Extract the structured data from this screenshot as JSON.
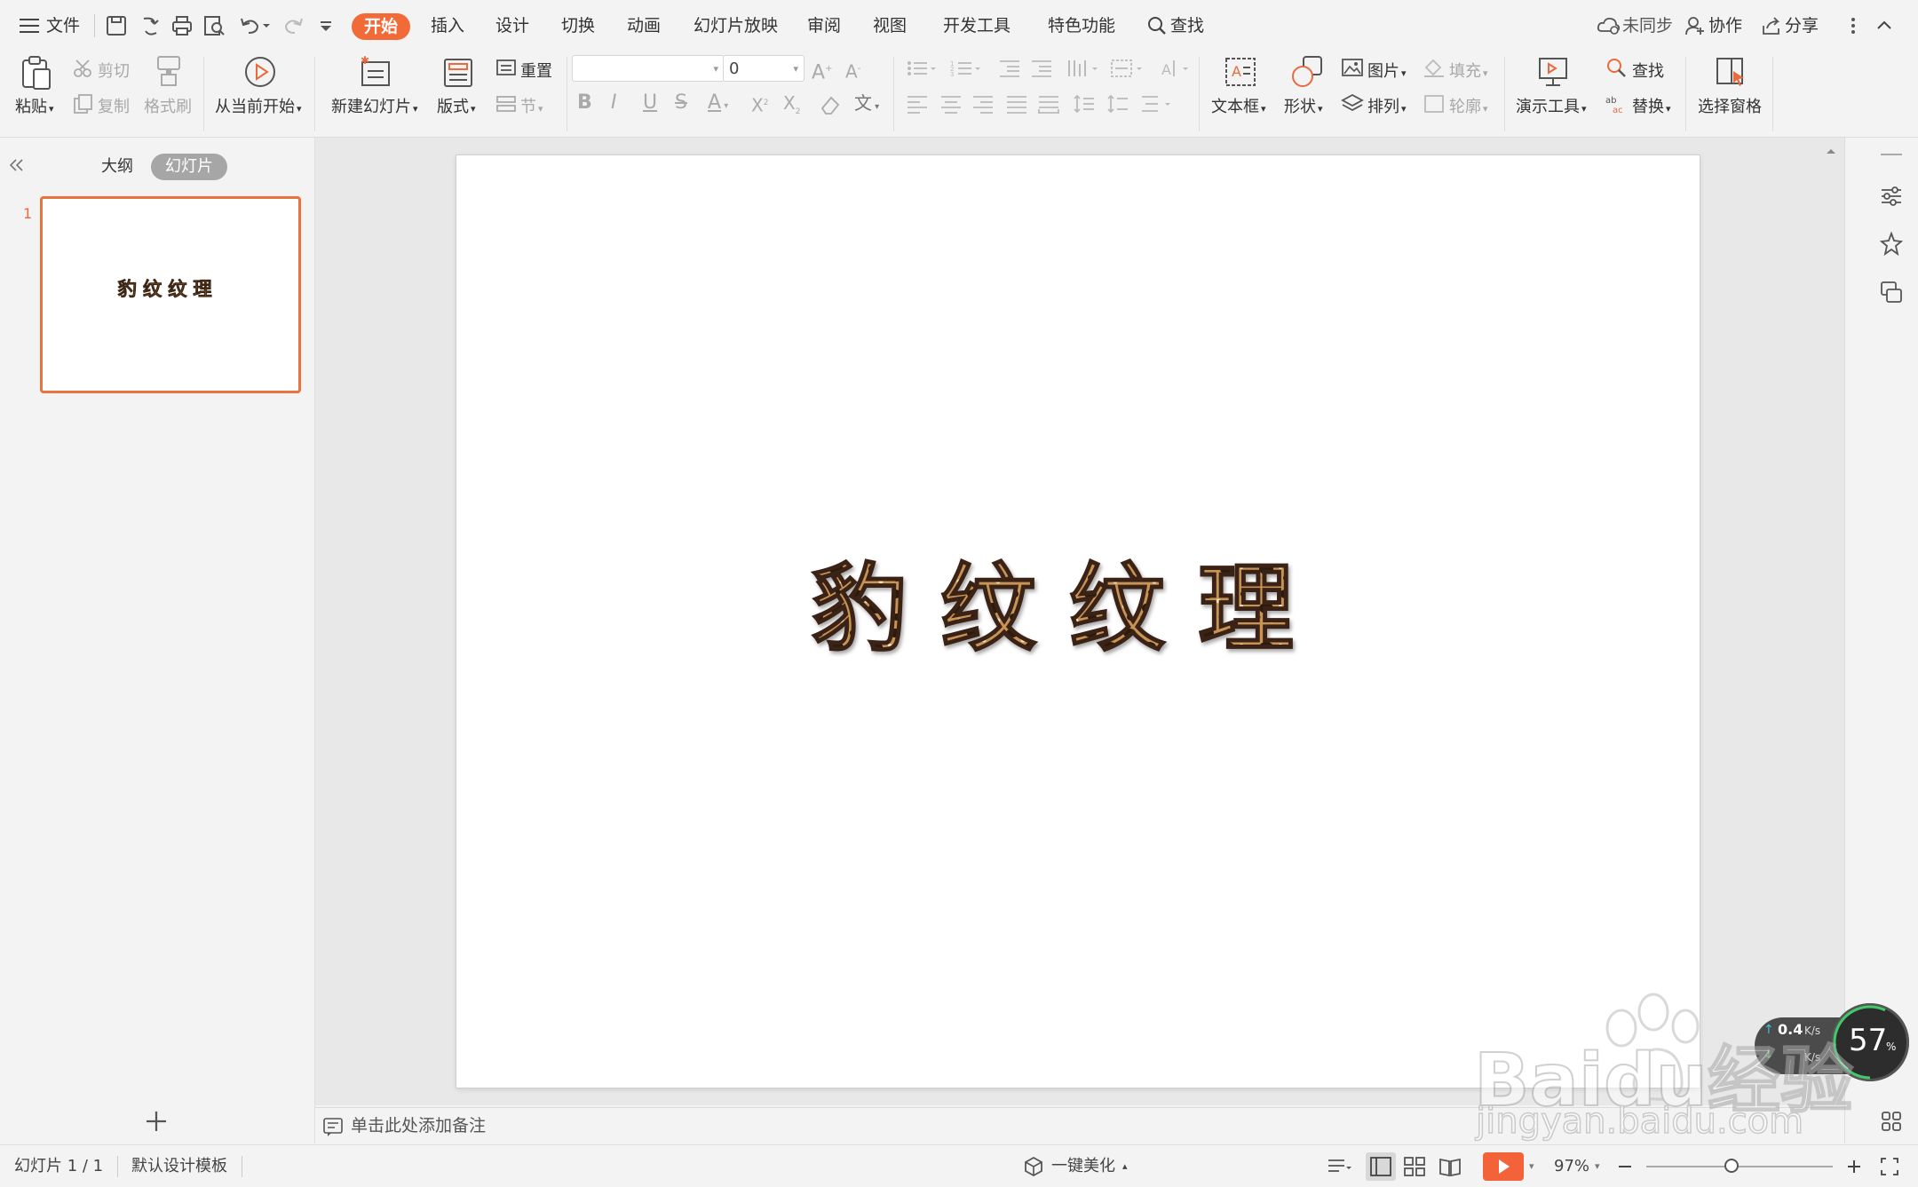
{
  "menubar": {
    "file_label": "文件",
    "tabs": [
      "开始",
      "插入",
      "设计",
      "切换",
      "动画",
      "幻灯片放映",
      "审阅",
      "视图",
      "开发工具",
      "特色功能"
    ],
    "search_label": "查找",
    "sync_label": "未同步",
    "collab_label": "协作",
    "share_label": "分享"
  },
  "ribbon": {
    "paste": "粘贴",
    "cut": "剪切",
    "copy": "复制",
    "format_painter": "格式刷",
    "from_current": "从当前开始",
    "new_slide": "新建幻灯片",
    "layout": "版式",
    "reset": "重置",
    "section": "节",
    "font_name": "",
    "font_size": "0",
    "text_box": "文本框",
    "shape": "形状",
    "picture": "图片",
    "fill": "填充",
    "arrange": "排列",
    "outline": "轮廓",
    "present_tools": "演示工具",
    "find": "查找",
    "replace": "替换",
    "select_pane": "选择窗格"
  },
  "leftpane": {
    "tab_outline": "大纲",
    "tab_slides": "幻灯片",
    "slide_number": "1",
    "add_icon": "plus-icon"
  },
  "slide": {
    "title_chars": [
      "豹",
      "纹",
      "纹",
      "理"
    ]
  },
  "notes": {
    "placeholder": "单击此处添加备注"
  },
  "status": {
    "slide_info": "幻灯片 1 / 1",
    "template": "默认设计模板",
    "beautify": "一键美化",
    "zoom": "97%"
  },
  "network": {
    "up_speed": "0.4",
    "unit_up": "K/s",
    "unit_down": "K/s",
    "percent": "57",
    "percent_sign": "%"
  },
  "watermark": {
    "brand": "Baidu经验",
    "url": "jingyan.baidu.com"
  },
  "colors": {
    "accent": "#f26a38",
    "play": "#f4623a",
    "leopard_base": "#c89455"
  }
}
